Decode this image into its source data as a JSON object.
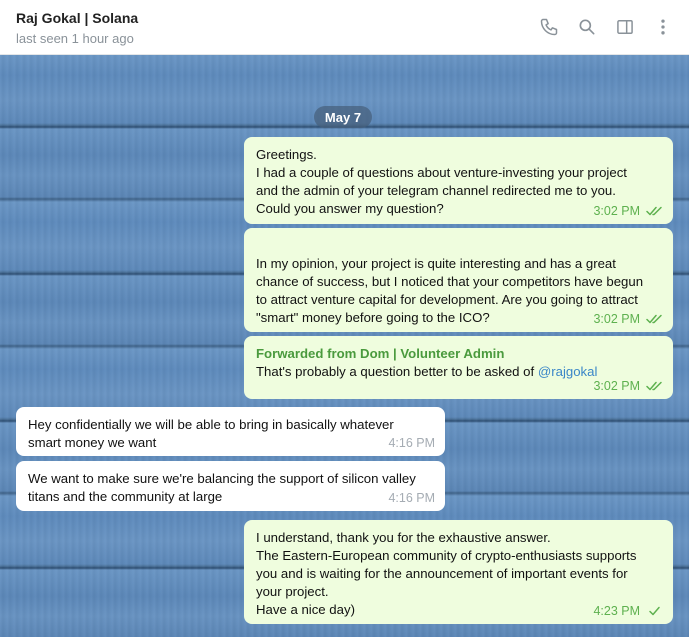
{
  "header": {
    "title": "Raj Gokal | Solana",
    "status": "last seen 1 hour ago",
    "icons": [
      "phone-icon",
      "search-icon",
      "sidebar-toggle-icon",
      "more-vert-icon"
    ]
  },
  "chat": {
    "date_badge": "May 7",
    "messages": [
      {
        "direction": "out",
        "text": "Greetings.\nI had a couple of questions about venture-investing your project\nand the admin of your telegram channel redirected me to you.\nCould you answer my question?",
        "time": "3:02 PM",
        "status": "read"
      },
      {
        "direction": "out",
        "text": "\nIn my opinion, your project is quite interesting and has a great\nchance of success, but I noticed that your competitors have begun\nto attract venture capital for development. Are you going to attract\n\"smart\" money before going to the ICO?",
        "time": "3:02 PM",
        "status": "read"
      },
      {
        "direction": "out",
        "forwarded_from": "Forwarded from Dom | Volunteer Admin",
        "text": "That's probably a question better to be asked of ",
        "mention": "@rajgokal",
        "time": "3:02 PM",
        "status": "read"
      },
      {
        "direction": "in",
        "text": "Hey confidentially we will be able to bring in basically whatever\nsmart money we want",
        "time": "4:16 PM"
      },
      {
        "direction": "in",
        "text": "We want to make sure we're balancing the support of silicon valley\ntitans and the community at large",
        "time": "4:16 PM"
      },
      {
        "direction": "out",
        "text": "I understand, thank you for the exhaustive answer.\nThe Eastern-European community of crypto-enthusiasts supports\nyou and is waiting for the announcement of important events for\nyour project.\nHave a nice day)",
        "time": "4:23 PM",
        "status": "sent"
      }
    ]
  },
  "colors": {
    "outgoing_bubble": "#effdde",
    "incoming_bubble": "#ffffff",
    "accent_green": "#5eb14f",
    "link_blue": "#3a86c8"
  }
}
